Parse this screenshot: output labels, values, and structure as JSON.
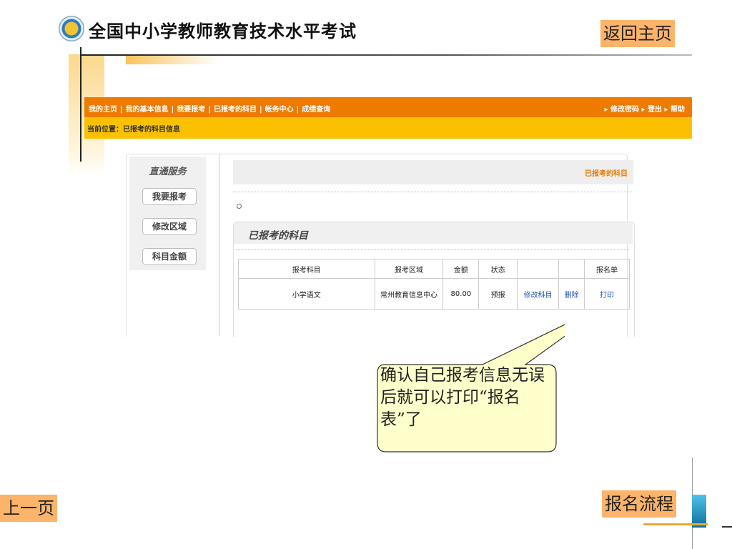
{
  "slide": {
    "title": "全国中小学教师教育技术水平考试",
    "home_button": "返回主页",
    "prev_button": "上一页",
    "flow_button": "报名流程",
    "callout": "确认自己报考信息无误后就可以打印“报名表”了"
  },
  "nav": {
    "links": [
      "我的主页",
      "我的基本信息",
      "我要报考",
      "已报考的科目",
      "帐务中心",
      "成绩查询"
    ],
    "right_links": [
      "修改密码",
      "登出",
      "帮助"
    ]
  },
  "breadcrumb": "当前位置：已报考的科目信息",
  "sidebar": {
    "title": "直通服务",
    "buttons": [
      "我要报考",
      "修改区域",
      "科目金额"
    ]
  },
  "main": {
    "header_label": "已报考的科目",
    "section_title": "已报考的科目"
  },
  "table": {
    "headers": [
      "报考科目",
      "报考区域",
      "金额",
      "状态",
      "",
      "",
      "报名单"
    ],
    "rows": [
      {
        "subject": "小学语文",
        "region": "常州教育信息中心",
        "amount": "80.00",
        "status": "预报",
        "edit": "修改科目",
        "delete": "删除",
        "print": "打印"
      }
    ]
  },
  "colors": {
    "nav_orange": "#ee7a00",
    "crumb_yellow": "#fbc100",
    "button_orange": "#fbb46a",
    "link_blue": "#1d4fb8"
  }
}
